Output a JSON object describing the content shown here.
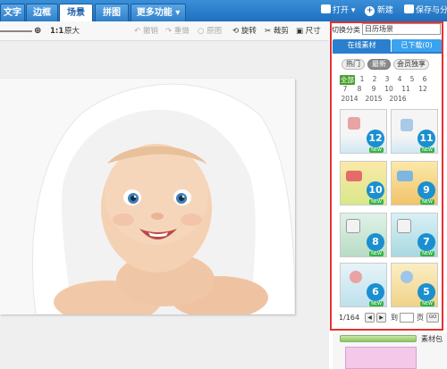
{
  "tabs": [
    "文字",
    "边框",
    "场景",
    "拼图",
    "更多功能"
  ],
  "active_tab": "场景",
  "top_right": {
    "open": "打开",
    "new": "新建",
    "save": "保存与分"
  },
  "toolbar": {
    "ratio": "1:1",
    "original": "原大",
    "undo": "撤销",
    "redo": "重做",
    "original_img": "原图",
    "rotate": "旋转",
    "crop": "裁剪",
    "size": "尺寸"
  },
  "panel": {
    "category_label": "切换分类",
    "category_value": "日历场景",
    "subtabs": [
      "在线素材",
      "已下载(0)"
    ],
    "chips": [
      "热门",
      "最新",
      "会员独享"
    ],
    "month_rows": [
      [
        "全部",
        "1",
        "2",
        "3",
        "4",
        "5",
        "6"
      ],
      [
        "7",
        "8",
        "9",
        "10",
        "11",
        "12"
      ],
      [
        "2014",
        "2015",
        "2016"
      ]
    ],
    "thumbs": [
      "12",
      "11",
      "10",
      "9",
      "8",
      "7",
      "6",
      "5"
    ],
    "new_badge": "NEW",
    "pager": {
      "page_info": "1/164",
      "goto_label": "到",
      "page_unit": "页",
      "go": "GO"
    }
  },
  "bottom": {
    "material_label": "素材包"
  },
  "colors": {
    "accent": "#1f6fbf",
    "highlight_box": "#e53030",
    "badge": "#1b8fd0",
    "new_badge": "#35b24a"
  }
}
